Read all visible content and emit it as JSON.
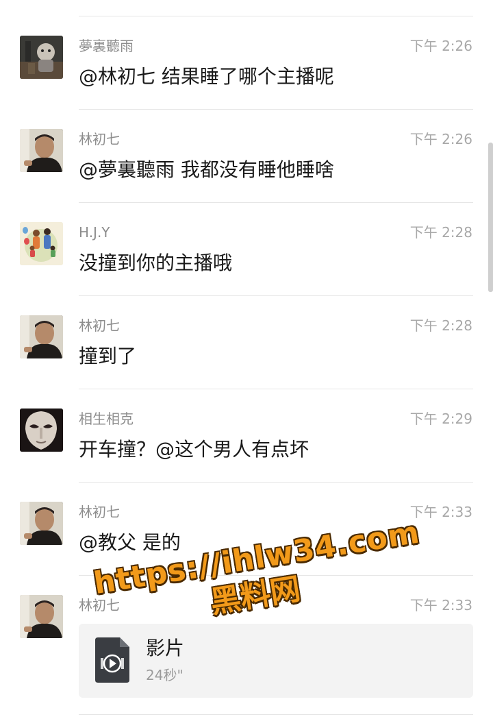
{
  "messages": [
    {
      "sender": "夢裏聽雨",
      "time": "下午 2:26",
      "text": "@林初七 结果睡了哪个主播呢",
      "avatar": "baby-figure-avatar"
    },
    {
      "sender": "林初七",
      "time": "下午 2:26",
      "text": "@夢裏聽雨 我都没有睡他睡啥",
      "avatar": "man-portrait-avatar"
    },
    {
      "sender": "H.J.Y",
      "time": "下午 2:28",
      "text": "没撞到你的主播哦",
      "avatar": "family-cartoon-avatar"
    },
    {
      "sender": "林初七",
      "time": "下午 2:28",
      "text": "撞到了",
      "avatar": "man-portrait-avatar"
    },
    {
      "sender": "相生相克",
      "time": "下午 2:29",
      "text": "开车撞？@这个男人有点坏",
      "avatar": "mask-avatar"
    },
    {
      "sender": "林初七",
      "time": "下午 2:33",
      "text": "@教父 是的",
      "avatar": "man-portrait-avatar"
    },
    {
      "sender": "林初七",
      "time": "下午 2:33",
      "file": {
        "name": "影片",
        "duration": "24秒\"",
        "icon": "video-file-icon"
      },
      "avatar": "man-portrait-avatar"
    }
  ],
  "watermark": {
    "url": "https://ihlw34.com",
    "name": "黑料网"
  },
  "colors": {
    "background": "#ffffff",
    "sender_text": "#8d8d8d",
    "time_text": "#a8a8a8",
    "message_text": "#1a1a1a",
    "file_card": "#f3f3f3",
    "watermark": "#f29a1a"
  }
}
